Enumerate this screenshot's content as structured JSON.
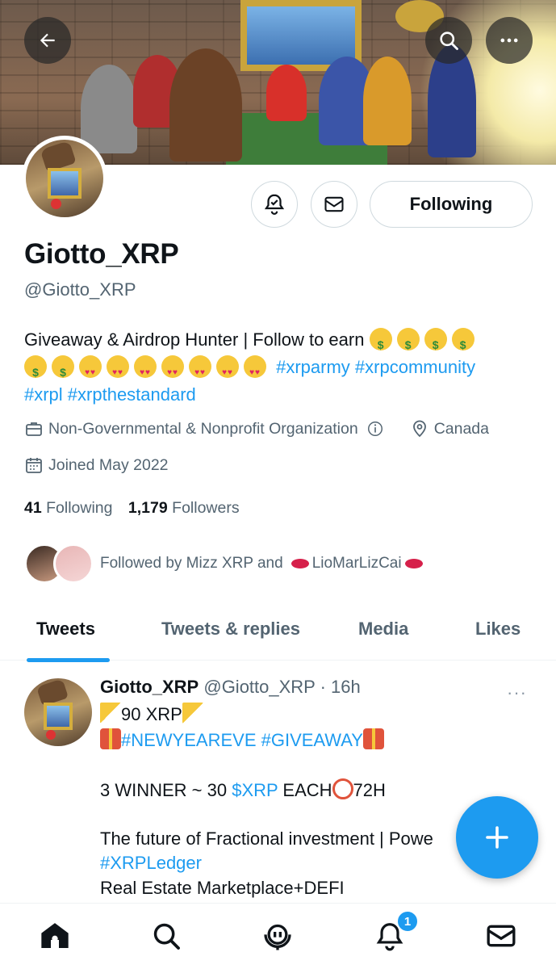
{
  "profile": {
    "display_name": "Giotto_XRP",
    "handle": "@Giotto_XRP",
    "bio": {
      "line1_text": "Giveaway & Airdrop Hunter | Follow to earn",
      "line2_tags": "#xrparmy #xrpcommunity",
      "line3_tags": "#xrpl #xrpthestandard"
    },
    "category": "Non-Governmental & Nonprofit Organization",
    "location": "Canada",
    "joined": "Joined May 2022",
    "following_count": "41",
    "following_label": "Following",
    "followers_count": "1,179",
    "followers_label": "Followers",
    "followed_by_prefix": "Followed by Mizz XRP and",
    "followed_by_second": "LioMarLizCai"
  },
  "actions": {
    "following_button": "Following"
  },
  "tabs": [
    {
      "label": "Tweets",
      "active": true
    },
    {
      "label": "Tweets & replies",
      "active": false
    },
    {
      "label": "Media",
      "active": false
    },
    {
      "label": "Likes",
      "active": false
    }
  ],
  "tweet": {
    "author_name": "Giotto_XRP",
    "author_meta": "@Giotto_XRP · 16h",
    "more": "···",
    "line1": "90 XRP",
    "line2_tags": "#NEWYEAREVE #GIVEAWAY",
    "line3_pre": "3 WINNER ~ 30 ",
    "line3_tag": "$XRP",
    "line3_mid": " EACH",
    "line3_post": "72H",
    "line4": "The future of Fractional investment | Powe",
    "line5_tag": "#XRPLedger",
    "line6": "Real Estate Marketplace+DEFI"
  },
  "nav": {
    "notification_badge": "1"
  },
  "colors": {
    "accent": "#1d9bf0",
    "text_primary": "#0f1419",
    "text_secondary": "#536471",
    "border": "#cfd9de"
  },
  "icons": [
    "back-arrow-icon",
    "search-icon",
    "more-icon",
    "notify-bell-icon",
    "mail-icon",
    "briefcase-icon",
    "info-icon",
    "location-pin-icon",
    "calendar-icon",
    "compose-plus-icon",
    "home-icon",
    "spaces-icon",
    "bell-icon"
  ]
}
